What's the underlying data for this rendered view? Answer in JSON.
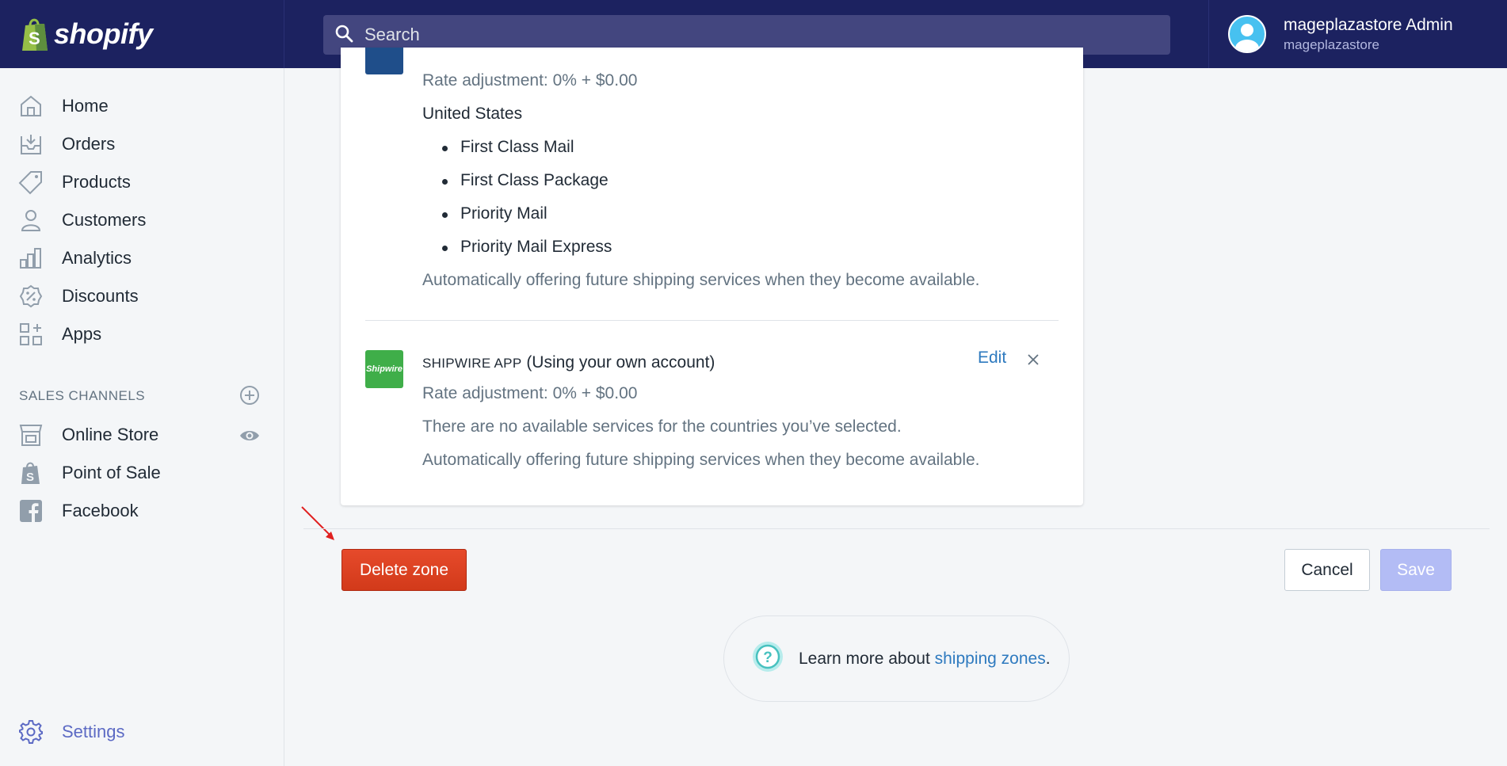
{
  "topbar": {
    "logo_text": "shopify",
    "search_placeholder": "Search",
    "user_name": "mageplazastore Admin",
    "user_store": "mageplazastore"
  },
  "sidebar": {
    "items": [
      {
        "label": "Home",
        "icon": "home-icon"
      },
      {
        "label": "Orders",
        "icon": "orders-icon"
      },
      {
        "label": "Products",
        "icon": "tag-icon"
      },
      {
        "label": "Customers",
        "icon": "person-icon"
      },
      {
        "label": "Analytics",
        "icon": "bar-chart-icon"
      },
      {
        "label": "Discounts",
        "icon": "discount-icon"
      },
      {
        "label": "Apps",
        "icon": "apps-icon"
      }
    ],
    "sales_channels_heading": "SALES CHANNELS",
    "channels": [
      {
        "label": "Online Store",
        "icon": "store-icon"
      },
      {
        "label": "Point of Sale",
        "icon": "pos-bag-icon"
      },
      {
        "label": "Facebook",
        "icon": "facebook-icon"
      }
    ],
    "settings_label": "Settings"
  },
  "card": {
    "usps": {
      "rate": "Rate adjustment: 0% + $0.00",
      "country": "United States",
      "services": [
        "First Class Mail",
        "First Class Package",
        "Priority Mail",
        "Priority Mail Express"
      ],
      "auto_note": "Automatically offering future shipping services when they become available."
    },
    "shipwire": {
      "logo_text": "Shipwire",
      "name": "SHIPWIRE APP",
      "account": "(Using your own account)",
      "edit_label": "Edit",
      "rate": "Rate adjustment: 0% + $0.00",
      "no_services": "There are no available services for the countries you’ve selected.",
      "auto_note": "Automatically offering future shipping services when they become available."
    }
  },
  "actions": {
    "delete_label": "Delete zone",
    "cancel_label": "Cancel",
    "save_label": "Save"
  },
  "help": {
    "prefix": "Learn more about ",
    "link": "shipping zones",
    "suffix": "."
  },
  "colors": {
    "topbar": "#1c2260",
    "delete": "#de3618",
    "save_disabled": "#b3bcf5",
    "link": "#2e7abf"
  }
}
